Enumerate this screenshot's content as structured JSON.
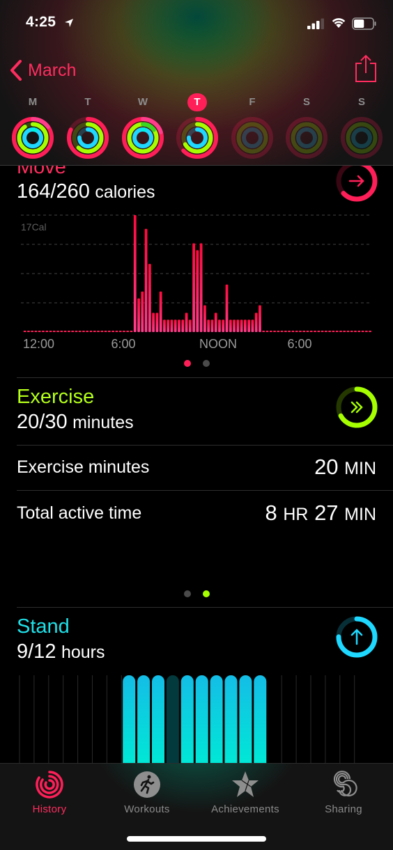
{
  "status_bar": {
    "time": "4:25",
    "location_icon": "location-arrow-icon",
    "signal_bars": 3,
    "signal_max": 4,
    "battery_level": 0.55
  },
  "nav": {
    "back_label": "March",
    "back_icon": "chevron-left-icon",
    "share_icon": "share-icon"
  },
  "colors": {
    "move": "#ff1f58",
    "move_light": "#ff3d8a",
    "exercise": "#a6ff00",
    "exercise_dark": "#3cd622",
    "stand": "#1fd8ff",
    "stand_light": "#00f0e0"
  },
  "week": [
    {
      "label": "M",
      "today": false,
      "move": 1.15,
      "exercise": 0.9,
      "stand": 1.05
    },
    {
      "label": "T",
      "today": false,
      "move": 0.82,
      "exercise": 0.62,
      "stand": 0.75
    },
    {
      "label": "W",
      "today": false,
      "move": 1.2,
      "exercise": 1.15,
      "stand": 1.03
    },
    {
      "label": "T",
      "today": true,
      "move": 0.63,
      "exercise": 0.67,
      "stand": 0.75
    },
    {
      "label": "F",
      "today": false,
      "move": 0,
      "exercise": 0,
      "stand": 0
    },
    {
      "label": "S",
      "today": false,
      "move": 0,
      "exercise": 0,
      "stand": 0
    },
    {
      "label": "S",
      "today": false,
      "move": 0,
      "exercise": 0,
      "stand": 0
    }
  ],
  "move": {
    "title": "Move",
    "current": "164/260",
    "unit": "calories",
    "progress": 0.63,
    "icon": "arrow-right-icon"
  },
  "chart_data": {
    "type": "bar",
    "title": "Move",
    "ylabel": "17Cal",
    "ylim": [
      0,
      17
    ],
    "grid": true,
    "slots_per_day": 96,
    "slot_minutes": 15,
    "first_bar_slot": 30,
    "tick_labels": [
      "12:00",
      "6:00",
      "NOON",
      "6:00"
    ],
    "tick_slots": [
      0,
      24,
      48,
      72
    ],
    "values": [
      17,
      4.9,
      5.9,
      15,
      9.9,
      2.8,
      2.8,
      5.9,
      1.8,
      1.8,
      1.8,
      1.8,
      1.8,
      1.8,
      2.8,
      1.8,
      12.9,
      11.9,
      12.9,
      3.9,
      1.8,
      1.8,
      2.8,
      1.8,
      1.8,
      6.9,
      1.8,
      1.8,
      1.8,
      1.8,
      1.8,
      1.8,
      1.8,
      2.8,
      3.9
    ]
  },
  "move_pager": {
    "count": 2,
    "active": 0
  },
  "exercise": {
    "title": "Exercise",
    "current": "20/30",
    "unit": "minutes",
    "progress": 0.67,
    "icon": "double-chevron-right-icon",
    "rows": [
      {
        "label": "Exercise minutes",
        "parts": [
          {
            "n": "20",
            "u": "MIN"
          }
        ]
      },
      {
        "label": "Total active time",
        "parts": [
          {
            "n": "8",
            "u": "HR"
          },
          {
            "n": "27",
            "u": "MIN"
          }
        ]
      }
    ]
  },
  "exercise_pager": {
    "count": 2,
    "active": 1
  },
  "stand": {
    "title": "Stand",
    "current": "9/12",
    "unit": "hours",
    "progress": 0.75,
    "icon": "arrow-up-icon",
    "hours_total": 24,
    "stood": [
      8,
      9,
      10,
      12,
      13,
      14,
      15,
      16,
      17
    ],
    "missed": [
      11
    ]
  },
  "tabs": [
    {
      "label": "History",
      "icon": "history-rings-icon",
      "active": true
    },
    {
      "label": "Workouts",
      "icon": "running-figure-icon",
      "active": false
    },
    {
      "label": "Achievements",
      "icon": "star-award-icon",
      "active": false
    },
    {
      "label": "Sharing",
      "icon": "sharing-s-icon",
      "active": false
    }
  ]
}
